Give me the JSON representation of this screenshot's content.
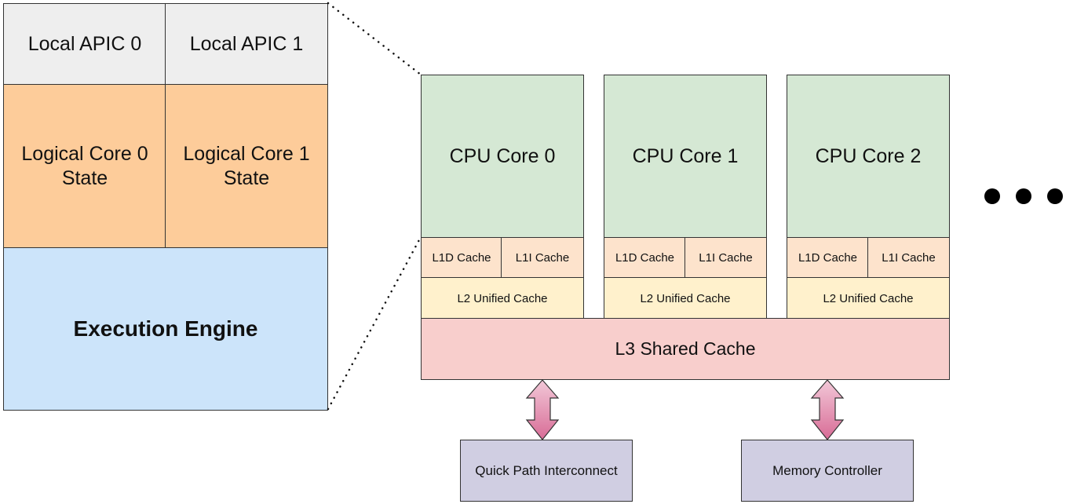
{
  "zoomed_core": {
    "apic": [
      "Local APIC 0",
      "Local APIC 1"
    ],
    "logical_cores": [
      "Logical Core 0\nState",
      "Logical Core 1\nState"
    ],
    "execution_engine": "Execution Engine"
  },
  "cpu_cores": [
    {
      "label": "CPU Core 0",
      "l1d": "L1D Cache",
      "l1i": "L1I Cache",
      "l2": "L2 Unified Cache"
    },
    {
      "label": "CPU Core 1",
      "l1d": "L1D Cache",
      "l1i": "L1I Cache",
      "l2": "L2 Unified Cache"
    },
    {
      "label": "CPU Core 2",
      "l1d": "L1D Cache",
      "l1i": "L1I Cache",
      "l2": "L2 Unified Cache"
    }
  ],
  "l3": "L3 Shared Cache",
  "external": {
    "qpi": "Quick Path Interconnect",
    "memory_controller": "Memory Controller"
  },
  "more_indicator": "ellipsis",
  "colors": {
    "apic": "#eeeeee",
    "logical": "#fdcc9a",
    "execution": "#cce4fa",
    "core": "#d5e8d4",
    "l1": "#fde3cc",
    "l2": "#fff1cc",
    "l3": "#f8cecc",
    "external": "#d0cee2",
    "arrow": "#d9739a"
  }
}
